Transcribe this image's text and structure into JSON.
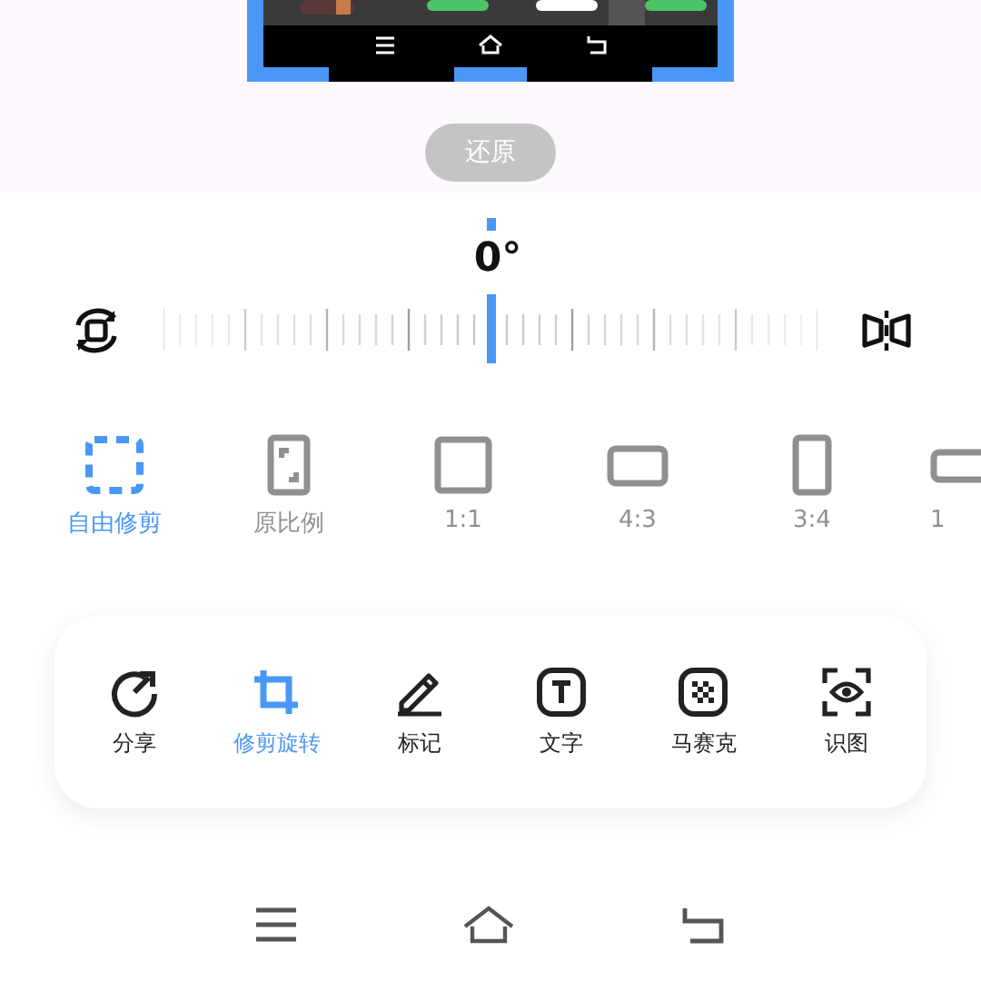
{
  "restore_button": "还原",
  "angle": "0°",
  "rotation_slider": {
    "level": 0.5
  },
  "aspect_ratios": [
    {
      "label": "自由修剪",
      "kind": "free",
      "selected": true
    },
    {
      "label": "原比例",
      "kind": "original",
      "selected": false
    },
    {
      "label": "1:1",
      "kind": "square",
      "selected": false
    },
    {
      "label": "4:3",
      "kind": "landscape",
      "selected": false
    },
    {
      "label": "3:4",
      "kind": "portrait",
      "selected": false
    },
    {
      "label": "1",
      "kind": "wide",
      "selected": false
    }
  ],
  "tools": [
    {
      "label": "分享",
      "kind": "share",
      "selected": false
    },
    {
      "label": "修剪旋转",
      "kind": "crop",
      "selected": true
    },
    {
      "label": "标记",
      "kind": "mark",
      "selected": false
    },
    {
      "label": "文字",
      "kind": "text",
      "selected": false
    },
    {
      "label": "马赛克",
      "kind": "mosaic",
      "selected": false
    },
    {
      "label": "识图",
      "kind": "lens",
      "selected": false
    }
  ]
}
